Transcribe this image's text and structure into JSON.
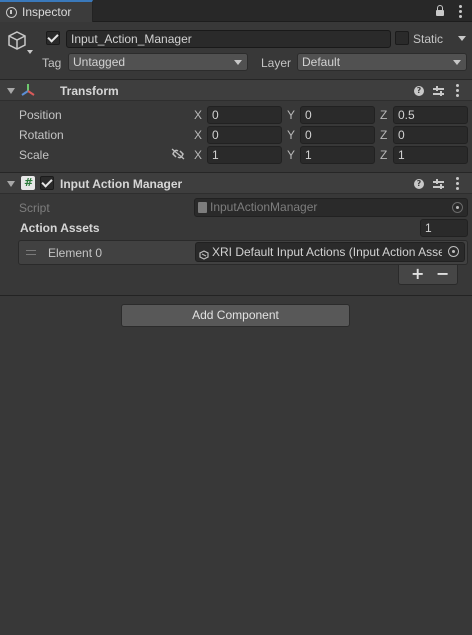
{
  "tab": {
    "label": "Inspector"
  },
  "gameobject": {
    "active": true,
    "name": "Input_Action_Manager",
    "static_label": "Static",
    "static_checked": false,
    "tag_label": "Tag",
    "tag_value": "Untagged",
    "layer_label": "Layer",
    "layer_value": "Default"
  },
  "transform": {
    "title": "Transform",
    "rows": [
      {
        "label": "Position",
        "x": "0",
        "y": "0",
        "z": "0.5"
      },
      {
        "label": "Rotation",
        "x": "0",
        "y": "0",
        "z": "0"
      },
      {
        "label": "Scale",
        "x": "1",
        "y": "1",
        "z": "1"
      }
    ],
    "axis": {
      "x": "X",
      "y": "Y",
      "z": "Z"
    }
  },
  "input_action_manager": {
    "title": "Input Action Manager",
    "enabled": true,
    "script_label": "Script",
    "script_value": "InputActionManager",
    "action_assets_label": "Action Assets",
    "action_assets_count": "1",
    "elements": [
      {
        "label": "Element 0",
        "value": "XRI Default Input Actions (Input Action Asset)"
      }
    ],
    "plus": "+",
    "minus": "−"
  },
  "add_component": {
    "label": "Add Component"
  },
  "colors": {
    "accent": "#3a79bb",
    "background": "#383838",
    "header": "#3e3e3e"
  }
}
